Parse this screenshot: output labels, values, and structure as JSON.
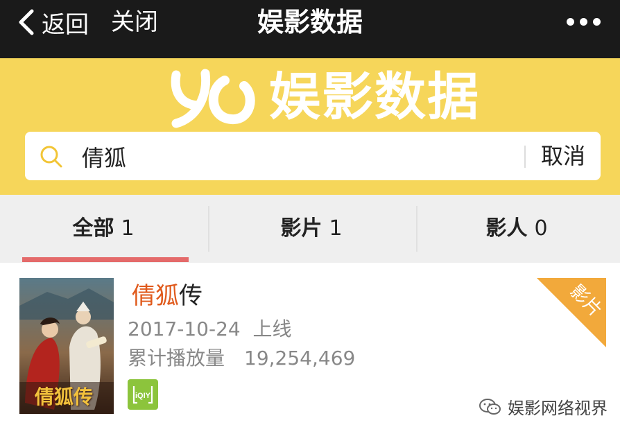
{
  "topbar": {
    "back_label": "返回",
    "close_label": "关闭",
    "title": "娱影数据"
  },
  "hero": {
    "logo_text": "娱影数据",
    "background_color": "#f6d65a"
  },
  "search": {
    "value": "倩狐",
    "cancel_label": "取消"
  },
  "tabs": [
    {
      "name": "全部",
      "count": "1",
      "active": true
    },
    {
      "name": "影片",
      "count": "1",
      "active": false
    },
    {
      "name": "影人",
      "count": "0",
      "active": false
    }
  ],
  "result": {
    "title_highlight": "倩狐",
    "title_rest": "传",
    "release_date": "2017-10-24",
    "release_suffix": "上线",
    "play_label": "累计播放量",
    "play_value": "19,254,469",
    "poster_title": "倩狐传",
    "platform_icon": "iqiyi-icon",
    "platform_text": "iQIY",
    "badge": "影片"
  },
  "watermark": {
    "text": "娱影网络视界"
  },
  "colors": {
    "highlight": "#e05a1c",
    "tab_underline": "#e46a6a",
    "badge": "#f2a93b",
    "platform": "#8cc43c"
  }
}
